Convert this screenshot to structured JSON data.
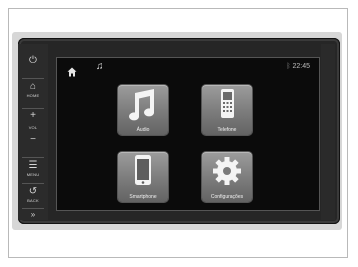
{
  "side_panel": {
    "power_icon": "power-icon",
    "home_label": "HOME",
    "vol_label": "VOL",
    "vol_up": "+",
    "vol_down": "−",
    "menu_label": "MENU",
    "back_label": "BACK",
    "skip_glyph": "»"
  },
  "status_bar": {
    "time": "22:45",
    "bluetooth_icon": "bluetooth-icon",
    "music_icon": "music-note-icon"
  },
  "apps": [
    {
      "label": "Áudio",
      "icon": "music-note-icon"
    },
    {
      "label": "Telefone",
      "icon": "phone-icon"
    },
    {
      "label": "Smartphone",
      "icon": "smartphone-icon"
    },
    {
      "label": "Configurações",
      "icon": "gear-icon"
    }
  ]
}
